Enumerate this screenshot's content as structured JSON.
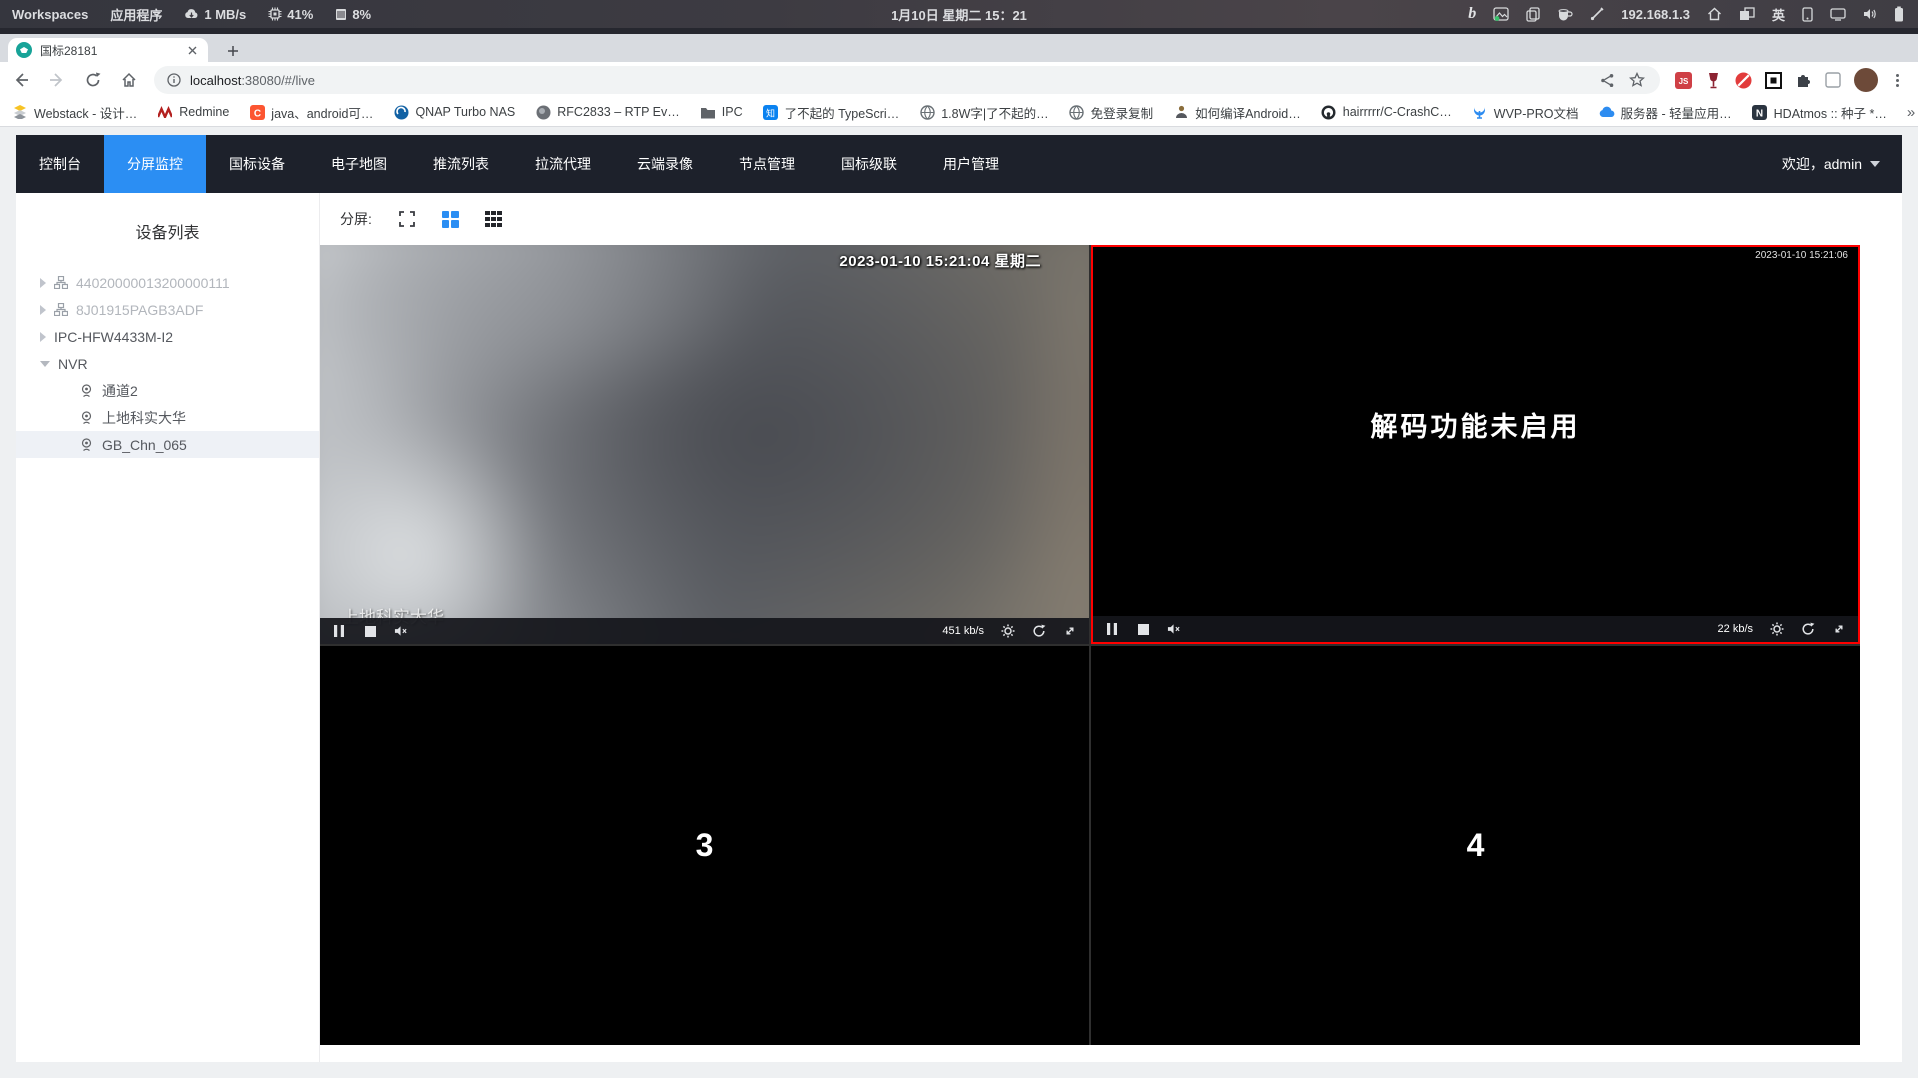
{
  "colors": {
    "accent_blue": "#2b8ef3",
    "nav_bg": "#1d212b",
    "selected_cell_border": "#ff0000",
    "favicon_teal": "#17a398"
  },
  "sysbar": {
    "workspaces": "Workspaces",
    "apps_menu": "应用程序",
    "net_speed": "1 MB/s",
    "cpu": "41%",
    "mem": "8%",
    "clock": "1月10日 星期二 15：21",
    "ip": "192.168.1.3",
    "input_method": "英"
  },
  "browser": {
    "tab_title": "国标28181",
    "url_host": "localhost",
    "url_rest": ":38080/#/live",
    "bookmarks": [
      {
        "icon": "webstack-icon",
        "label": "Webstack - 设计…"
      },
      {
        "icon": "redmine-icon",
        "label": "Redmine"
      },
      {
        "icon": "csdn-icon",
        "label": "java、android可…"
      },
      {
        "icon": "qnap-icon",
        "label": "QNAP Turbo NAS"
      },
      {
        "icon": "rfc-doc-icon",
        "label": "RFC2833 – RTP Ev…"
      },
      {
        "icon": "folder-icon",
        "label": "IPC"
      },
      {
        "icon": "zhihu-icon",
        "label": "了不起的 TypeScri…"
      },
      {
        "icon": "globe-icon",
        "label": "1.8W字|了不起的…"
      },
      {
        "icon": "globe-icon",
        "label": "免登录复制"
      },
      {
        "icon": "person-icon",
        "label": "如何编译Android…"
      },
      {
        "icon": "github-icon",
        "label": "hairrrrr/C-CrashC…"
      },
      {
        "icon": "wvp-icon",
        "label": "WVP-PRO文档"
      },
      {
        "icon": "cloud-icon",
        "label": "服务器 - 轻量应用…"
      },
      {
        "icon": "hdatmos-icon",
        "label": "HDAtmos :: 种子 *…"
      }
    ],
    "bookmarks_overflow": "»"
  },
  "nav": {
    "tabs": [
      "控制台",
      "分屏监控",
      "国标设备",
      "电子地图",
      "推流列表",
      "拉流代理",
      "云端录像",
      "节点管理",
      "国标级联",
      "用户管理"
    ],
    "active_tab": "分屏监控",
    "welcome": "欢迎，admin"
  },
  "sidebar": {
    "title": "设备列表",
    "devices": [
      {
        "label": "44020000013200000111",
        "status": "offline"
      },
      {
        "label": "8J01915PAGB3ADF",
        "status": "offline"
      },
      {
        "label": "IPC-HFW4433M-I2",
        "status": "online"
      },
      {
        "label": "NVR",
        "status": "online",
        "expanded": true
      }
    ],
    "channels": [
      {
        "label": "通道2"
      },
      {
        "label": "上地科实大华"
      },
      {
        "label": "GB_Chn_065",
        "selected": true
      }
    ]
  },
  "split": {
    "label": "分屏:"
  },
  "players": {
    "p1": {
      "timestamp": "2023-01-10 15:21:04 星期二",
      "name": "上地科实大华",
      "bitrate": "451 kb/s"
    },
    "p2": {
      "timestamp": "2023-01-10 15:21:06",
      "message": "解码功能未启用",
      "bitrate": "22 kb/s"
    },
    "p3": {
      "number": "3"
    },
    "p4": {
      "number": "4"
    }
  }
}
